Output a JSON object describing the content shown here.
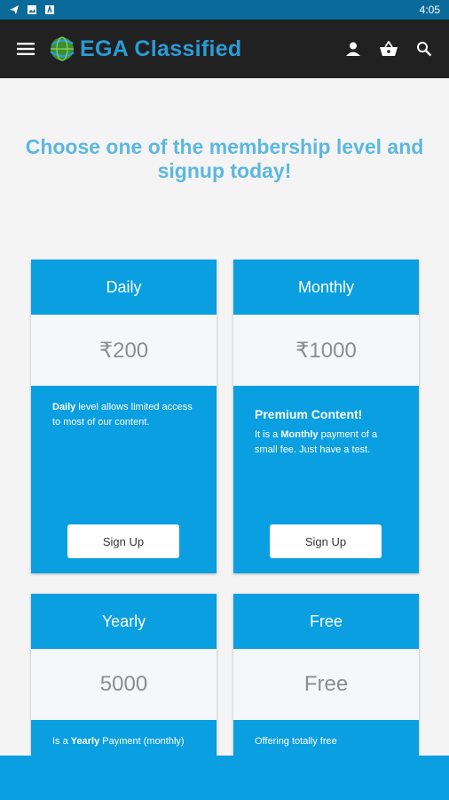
{
  "status": {
    "time": "4:05"
  },
  "app": {
    "name": "EGA Classified"
  },
  "heading": "Choose one of the membership level and signup today!",
  "levels": [
    {
      "title": "Daily",
      "price": "₹200",
      "subheading": "",
      "desc_bold": "Daily",
      "desc_rest": " level allows limited access to most of our content.",
      "button": "Sign Up"
    },
    {
      "title": "Monthly",
      "price": "₹1000",
      "subheading": "Premium Content!",
      "desc_prefix": "It is a ",
      "desc_bold": "Monthly",
      "desc_rest": " payment of a small fee. Just have a test.",
      "button": "Sign Up"
    },
    {
      "title": "Yearly",
      "price": "5000",
      "desc_prefix": "Is a ",
      "desc_bold": "Yearly",
      "desc_rest": " Payment (monthly)"
    },
    {
      "title": "Free",
      "price": "Free",
      "desc_rest": "Offering totally free"
    }
  ],
  "colors": {
    "accent": "#0a9fe0",
    "status_bar": "#0a6b9a",
    "toolbar": "#212121",
    "heading": "#5cb8e0"
  },
  "icons": [
    "telegram-icon",
    "image-icon",
    "app-icon",
    "menu-icon",
    "globe-logo-icon",
    "user-icon",
    "basket-icon",
    "search-icon"
  ]
}
